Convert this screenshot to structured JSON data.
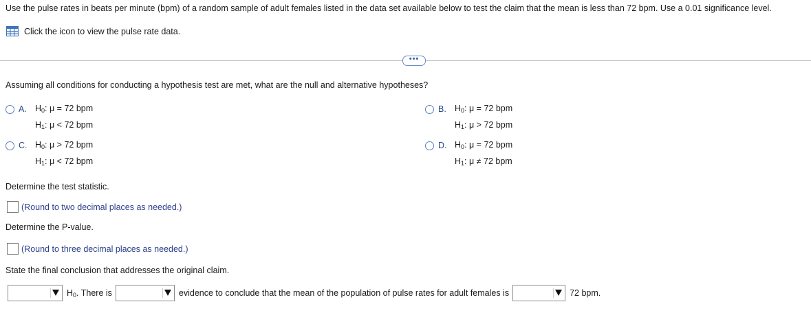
{
  "prompt": "Use the pulse rates in beats per minute (bpm) of a random sample of adult females listed in the data set available below to test the claim that the mean is less than 72 bpm. Use a 0.01 significance level.",
  "data_link": "Click the icon to view the pulse rate data.",
  "more_button": "•••",
  "question_hypotheses": "Assuming all conditions for conducting a hypothesis test are met, what are the null and alternative hypotheses?",
  "options": {
    "A": {
      "letter": "A.",
      "h0": ": μ = 72 bpm",
      "h1": ": μ < 72 bpm"
    },
    "B": {
      "letter": "B.",
      "h0": ": μ = 72 bpm",
      "h1": ": μ > 72 bpm"
    },
    "C": {
      "letter": "C.",
      "h0": ": μ > 72 bpm",
      "h1": ": μ < 72 bpm"
    },
    "D": {
      "letter": "D.",
      "h0": ": μ = 72 bpm",
      "h1": ": μ ≠ 72 bpm"
    }
  },
  "h_symbol": "H",
  "sub0": "0",
  "sub1": "1",
  "question_test_stat": "Determine the test statistic.",
  "hint_test_stat": "(Round to two decimal places as needed.)",
  "question_pvalue": "Determine the P-value.",
  "hint_pvalue": "(Round to three decimal places as needed.)",
  "question_conclusion": "State the final conclusion that addresses the original claim.",
  "conclusion": {
    "h0_tail": ". There is",
    "middle": "evidence to conclude that the mean of the population of pulse rates for adult females is",
    "end": "72 bpm."
  }
}
